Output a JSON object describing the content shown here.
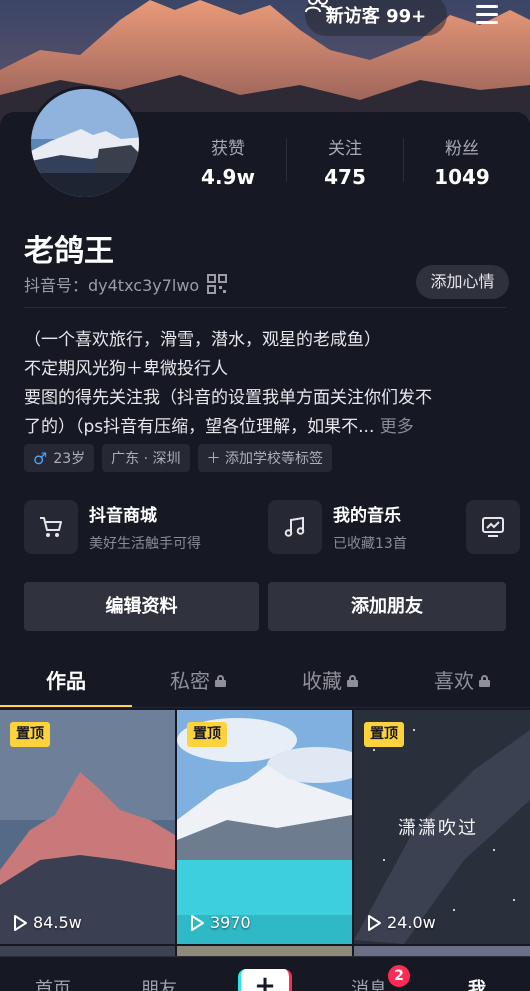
{
  "header": {
    "visitor_label": "新访客 99+"
  },
  "profile": {
    "nickname": "老鸽王",
    "douyin_id": "抖音号：dy4txc3y7lwo",
    "mood_button": "添加心情",
    "stats": [
      {
        "label": "获赞",
        "value": "4.9w"
      },
      {
        "label": "关注",
        "value": "475"
      },
      {
        "label": "粉丝",
        "value": "1049"
      }
    ],
    "bio_lines": [
      "（一个喜欢旅行，滑雪，潜水，观星的老咸鱼）",
      "不定期风光狗＋卑微投行人",
      "要图的得先关注我（抖音的设置我单方面关注你们发不",
      "了的）（ps抖音有压缩，望各位理解，如果不..."
    ],
    "bio_more": "更多",
    "tags": [
      {
        "icon": "male-icon",
        "label": "23岁"
      },
      {
        "label": "广东 · 深圳"
      },
      {
        "label": "＋ 添加学校等标签"
      }
    ]
  },
  "services": [
    {
      "icon": "cart-icon",
      "title": "抖音商城",
      "subtitle": "美好生活触手可得"
    },
    {
      "icon": "music-note-icon",
      "title": "我的音乐",
      "subtitle": "已收藏13首"
    },
    {
      "icon": "chart-screen-icon"
    }
  ],
  "actions": {
    "edit_profile": "编辑资料",
    "add_friend": "添加朋友"
  },
  "tabs": [
    {
      "label": "作品",
      "active": true,
      "locked": false
    },
    {
      "label": "私密",
      "active": false,
      "locked": true
    },
    {
      "label": "收藏",
      "active": false,
      "locked": true
    },
    {
      "label": "喜欢",
      "active": false,
      "locked": true
    }
  ],
  "videos": [
    {
      "pinned_label": "置顶",
      "plays": "84.5w"
    },
    {
      "pinned_label": "置顶",
      "plays": "3970"
    },
    {
      "pinned_label": "置顶",
      "plays": "24.0w",
      "overlay_text": "潇潇吹过"
    }
  ],
  "bottom_nav": {
    "home": "首页",
    "friends": "朋友",
    "plus": "+",
    "messages": "消息",
    "messages_badge": "2",
    "me": "我"
  },
  "colors": {
    "background": "#161823",
    "accent_yellow": "#fed35a",
    "badge_red": "#fe2c55",
    "male_blue": "#4aa3ff"
  }
}
